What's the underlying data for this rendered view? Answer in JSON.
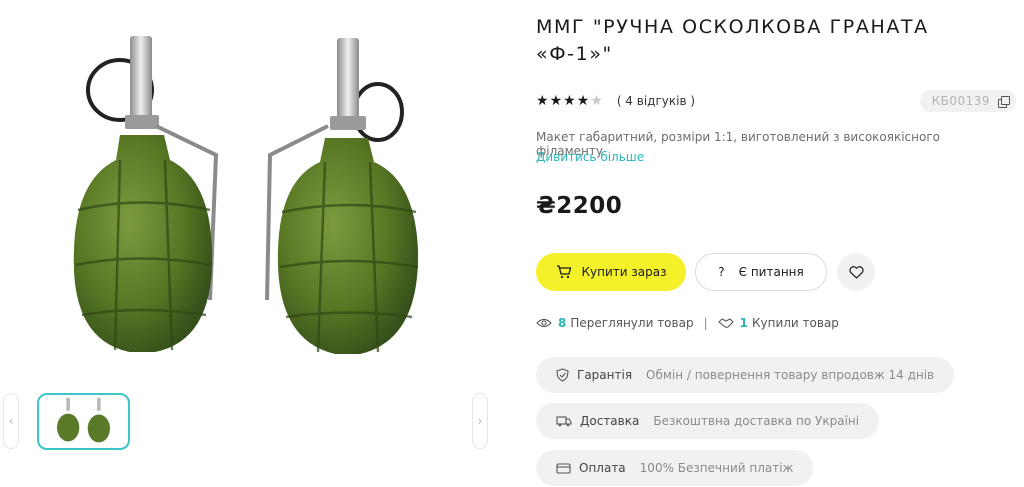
{
  "product": {
    "title_line1": "ММГ \"РУЧНА ОСКОЛКОВА ГРАНАТА",
    "title_line2": "«Ф-1»\"",
    "rating": 4,
    "rating_max": 5,
    "reviews": "( 4 відгуків )",
    "sku": "КБ00139",
    "description": "Макет габаритний, розміри 1:1, виготовлений з високоякісного філаменту",
    "more_link": "Дивитись більше",
    "price": "₴2200"
  },
  "actions": {
    "buy_label": "Купити зараз",
    "ask_label": "Є питання",
    "ask_icon": "?"
  },
  "stats": {
    "viewed_count": "8",
    "viewed_label": "Переглянули товар",
    "separator": "|",
    "bought_count": "1",
    "bought_label": "Купили товар"
  },
  "features": {
    "warranty_label": "Гарантія",
    "warranty_value": "Обмін / повернення товару впродовж 14 днів",
    "delivery_label": "Доставка",
    "delivery_value": "Безкоштвна доставка по Україні",
    "payment_label": "Оплата",
    "payment_value": "100% Безпечний платіж"
  },
  "icons": {
    "star": "star-icon",
    "copy": "copy-icon",
    "cart": "cart-icon",
    "heart": "heart-icon",
    "eye": "eye-icon",
    "handshake": "handshake-icon",
    "shield": "shield-icon",
    "truck": "truck-icon",
    "card": "card-icon",
    "chevron_left": "‹",
    "chevron_right": "›"
  },
  "colors": {
    "accent_teal": "#29b6b8",
    "buy_yellow": "#f4f12b",
    "grenade_green": "#5a7a2a"
  }
}
